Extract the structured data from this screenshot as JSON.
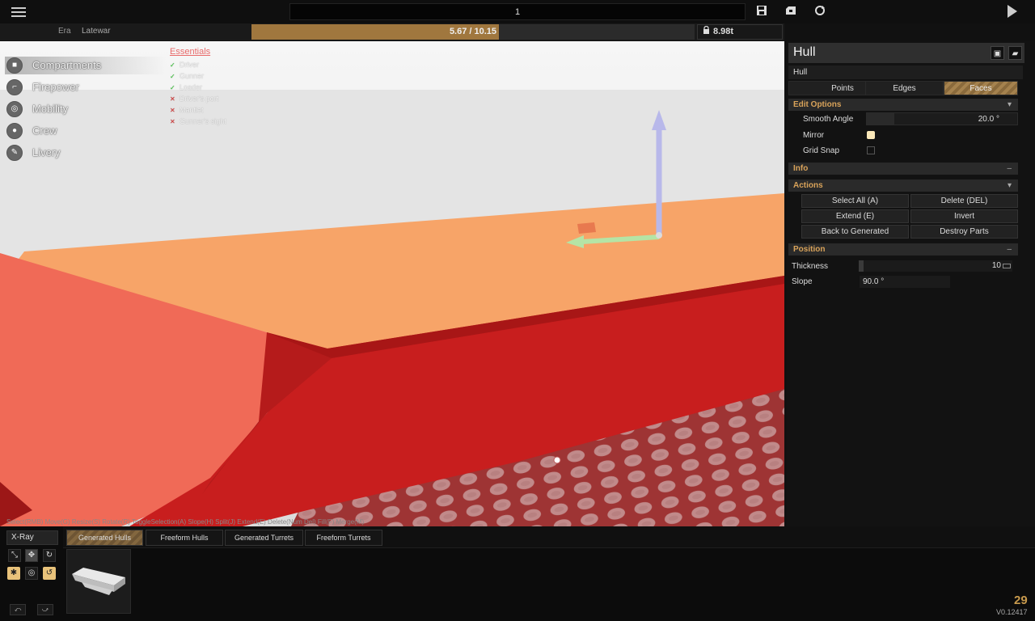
{
  "topbar": {
    "title": "1"
  },
  "statbar": {
    "era_label": "Era",
    "era_value": "Latewar",
    "weight_text": "5.67 / 10.15",
    "weight_ratio": 0.5586,
    "tonnage": "8.98t"
  },
  "nav": [
    {
      "label": "Compartments",
      "icon": "compartment-icon",
      "active": true
    },
    {
      "label": "Firepower",
      "icon": "cannon-icon"
    },
    {
      "label": "Mobility",
      "icon": "wheel-icon"
    },
    {
      "label": "Crew",
      "icon": "person-icon"
    },
    {
      "label": "Livery",
      "icon": "brush-icon"
    }
  ],
  "essentials": {
    "title": "Essentials",
    "items": [
      {
        "label": "Driver",
        "ok": true
      },
      {
        "label": "Gunner",
        "ok": true
      },
      {
        "label": "Loader",
        "ok": true
      },
      {
        "label": "Driver's port",
        "ok": false
      },
      {
        "label": "Mantlet",
        "ok": false
      },
      {
        "label": "Gunner's sight",
        "ok": false
      }
    ]
  },
  "shortcuts": "Select(RMB) Move(G) Resize(S) Rotate(R) ToggleSelection(A) Slope(H) Split(J) Extend(E) Delete(Num Del) Fill(F) Merge(M)",
  "panel": {
    "title": "Hull",
    "part_name": "Hull",
    "modes": [
      "Points",
      "Edges",
      "Faces"
    ],
    "active_mode": "Faces",
    "edit_options": {
      "title": "Edit Options",
      "smooth_angle_label": "Smooth Angle",
      "smooth_angle_value": "20.0 °",
      "mirror_label": "Mirror",
      "mirror_checked": true,
      "grid_snap_label": "Grid Snap",
      "grid_snap_checked": false
    },
    "info_title": "Info",
    "actions": {
      "title": "Actions",
      "select_all": "Select All (A)",
      "delete": "Delete (DEL)",
      "extend": "Extend (E)",
      "invert": "Invert",
      "back_to_generated": "Back to Generated",
      "destroy_parts": "Destroy Parts"
    },
    "position": {
      "title": "Position",
      "thickness_label": "Thickness",
      "thickness_value": "10",
      "slope_label": "Slope",
      "slope_value": "90.0 °"
    }
  },
  "bottom": {
    "xray": "X-Ray",
    "tabs": [
      "Generated Hulls",
      "Freeform Hulls",
      "Generated Turrets",
      "Freeform Turrets"
    ],
    "active_tab": "Generated Hulls",
    "fps": "29",
    "version": "V0.12417"
  },
  "colors": {
    "accent": "#a0773e",
    "hull_red": "#c81e1e",
    "hull_orange": "#f7a468",
    "section_title": "#d9a35a"
  }
}
